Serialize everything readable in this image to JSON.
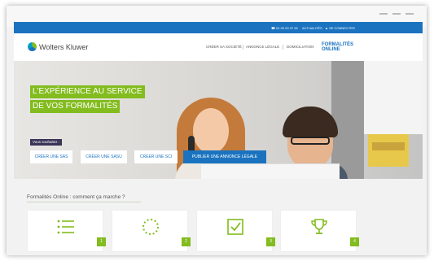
{
  "topbar": {
    "phone": "☎ 01 00 00 37 00",
    "actualites": "ACTUALITÉS",
    "login": "▲ SE CONNECTER"
  },
  "header": {
    "logo": "Wolters Kluwer",
    "nav": [
      "CRÉER SA SOCIÉTÉ",
      "ANNONCE LÉGALE",
      "DOMICILIATION"
    ],
    "active_line1": "FORMALITÉS",
    "active_line2": "ONLINE"
  },
  "hero": {
    "headline_line1": "L'EXPÉRIENCE AU SERVICE",
    "headline_line2": "DE VOS FORMALITÉS",
    "label": "Vous souhaitez :",
    "buttons": [
      "CRÉER UNE SAS",
      "CRÉER UNE SASU",
      "CRÉER UNE SCI",
      "PUBLIER UNE ANNONCE LÉGALE"
    ]
  },
  "section": {
    "title": "Formalités Online : comment ça marche ?"
  },
  "steps": [
    {
      "number": "1",
      "icon": "list-icon"
    },
    {
      "number": "2",
      "icon": "dotted-circle-icon"
    },
    {
      "number": "3",
      "icon": "checkbox-icon"
    },
    {
      "number": "4",
      "icon": "trophy-icon"
    }
  ],
  "colors": {
    "brand_blue": "#1b73c0",
    "accent_green": "#82bc1e",
    "label_purple": "#3a3557"
  }
}
